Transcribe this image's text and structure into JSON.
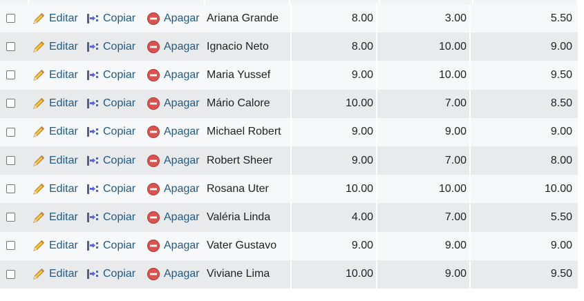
{
  "actions": {
    "edit_label": "Editar",
    "copy_label": "Copiar",
    "delete_label": "Apagar"
  },
  "icons": {
    "edit": "pencil-icon",
    "copy": "copy-icon",
    "delete": "delete-icon"
  },
  "colors": {
    "link": "#235a81",
    "row_light": "#f7f8fa",
    "row_dark": "#e9eaec",
    "delete_red": "#d9534f"
  },
  "rows": [
    {
      "name": "Ariana Grande",
      "n1": "8.00",
      "n2": "3.00",
      "n3": "5.50"
    },
    {
      "name": "Ignacio Neto",
      "n1": "8.00",
      "n2": "10.00",
      "n3": "9.00"
    },
    {
      "name": "Maria Yussef",
      "n1": "9.00",
      "n2": "10.00",
      "n3": "9.50"
    },
    {
      "name": "Mário Calore",
      "n1": "10.00",
      "n2": "7.00",
      "n3": "8.50"
    },
    {
      "name": "Michael Robert",
      "n1": "9.00",
      "n2": "9.00",
      "n3": "9.00"
    },
    {
      "name": "Robert Sheer",
      "n1": "9.00",
      "n2": "7.00",
      "n3": "8.00"
    },
    {
      "name": "Rosana Uter",
      "n1": "10.00",
      "n2": "10.00",
      "n3": "10.00"
    },
    {
      "name": "Valéria Linda",
      "n1": "4.00",
      "n2": "7.00",
      "n3": "5.50"
    },
    {
      "name": "Vater Gustavo",
      "n1": "9.00",
      "n2": "9.00",
      "n3": "9.00"
    },
    {
      "name": "Viviane Lima",
      "n1": "10.00",
      "n2": "9.00",
      "n3": "9.50"
    }
  ]
}
